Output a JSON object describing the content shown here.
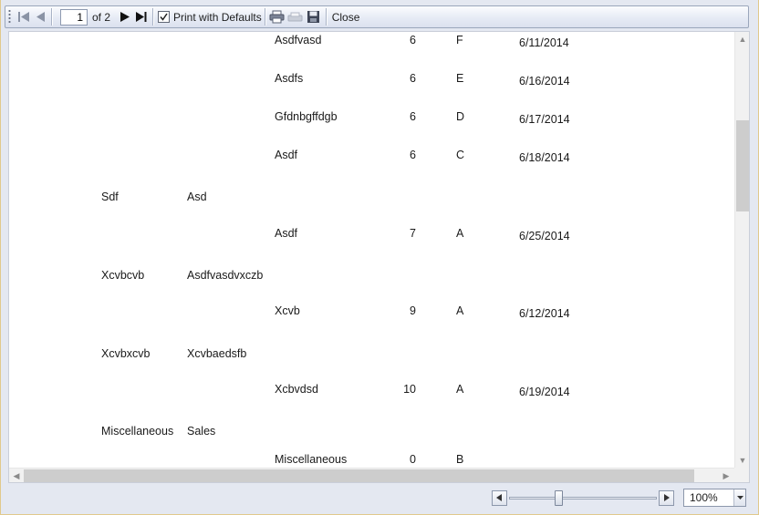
{
  "toolbar": {
    "first_page_icon": "first-page-icon",
    "prev_page_icon": "previous-page-icon",
    "current_page": "1",
    "page_count_text": "of 2",
    "next_page_icon": "next-page-icon",
    "last_page_icon": "last-page-icon",
    "print_with_defaults_label": "Print with Defaults",
    "print_with_defaults_checked": true,
    "print_icon": "printer-icon",
    "page_setup_icon": "page-setup-icon",
    "save_icon": "save-icon",
    "close_label": "Close"
  },
  "report": {
    "rows": [
      {
        "item": "Asdfvasd",
        "qty": "6",
        "grade": "F",
        "date": "6/11/2014"
      },
      {
        "item": "Asdfs",
        "qty": "6",
        "grade": "E",
        "date": "6/16/2014"
      },
      {
        "item": "Gfdnbgffdgb",
        "qty": "6",
        "grade": "D",
        "date": "6/17/2014"
      },
      {
        "item": "Asdf",
        "qty": "6",
        "grade": "C",
        "date": "6/18/2014"
      },
      {
        "group1": "Sdf",
        "group2": "Asd"
      },
      {
        "item": "Asdf",
        "qty": "7",
        "grade": "A",
        "date": "6/25/2014"
      },
      {
        "group1": "Xcvbcvb",
        "group2": "Asdfvasdvxczb"
      },
      {
        "item": "Xcvb",
        "qty": "9",
        "grade": "A",
        "date": "6/12/2014"
      },
      {
        "group1": "Xcvbxcvb",
        "group2": "Xcvbaedsfb"
      },
      {
        "item": "Xcbvdsd",
        "qty": "10",
        "grade": "A",
        "date": "6/19/2014"
      },
      {
        "group1": "Miscellaneous",
        "group2": "Sales"
      },
      {
        "item": "Miscellaneous",
        "qty": "0",
        "grade": "B",
        "date": ""
      }
    ]
  },
  "zoom": {
    "level_text": "100%",
    "slider_fraction": 0.33
  },
  "colors": {
    "toolbar_border": "#9aa6bb",
    "window_border": "#e1c98c",
    "scrollbar_thumb": "#cdcdcd"
  }
}
